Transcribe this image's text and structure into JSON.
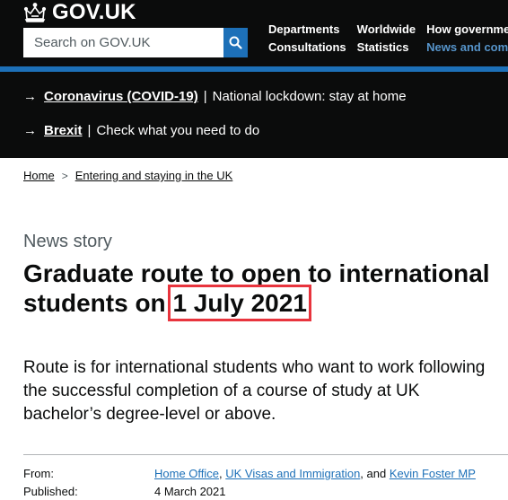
{
  "header": {
    "logo_text": "GOV.UK",
    "search_placeholder": "Search on GOV.UK",
    "nav": [
      {
        "label": "Departments"
      },
      {
        "label": "Worldwide"
      },
      {
        "label": "How government"
      },
      {
        "label": "Consultations"
      },
      {
        "label": "Statistics"
      },
      {
        "label": "News and comm"
      }
    ]
  },
  "notices": [
    {
      "link": "Coronavirus (COVID-19)",
      "text": "National lockdown: stay at home"
    },
    {
      "link": "Brexit",
      "text": "Check what you need to do"
    }
  ],
  "breadcrumb": [
    {
      "label": "Home"
    },
    {
      "label": "Entering and staying in the UK"
    }
  ],
  "article": {
    "caption": "News story",
    "title_part1": "Graduate route to open to international students on ",
    "title_highlight": "1 July 2021",
    "lead": "Route is for international students who want to work following the successful completion of a course of study at UK bachelor’s degree-level or above."
  },
  "meta": {
    "from_label": "From:",
    "from_links": [
      "Home Office",
      "UK Visas and Immigration",
      "Kevin Foster MP"
    ],
    "from_sep1": ", ",
    "from_sep2": ", and ",
    "published_label": "Published:",
    "published_value": "4 March 2021"
  },
  "colors": {
    "header_bg": "#0b0c0c",
    "brand_blue": "#1d70b8",
    "highlight_red": "#e8343d"
  }
}
